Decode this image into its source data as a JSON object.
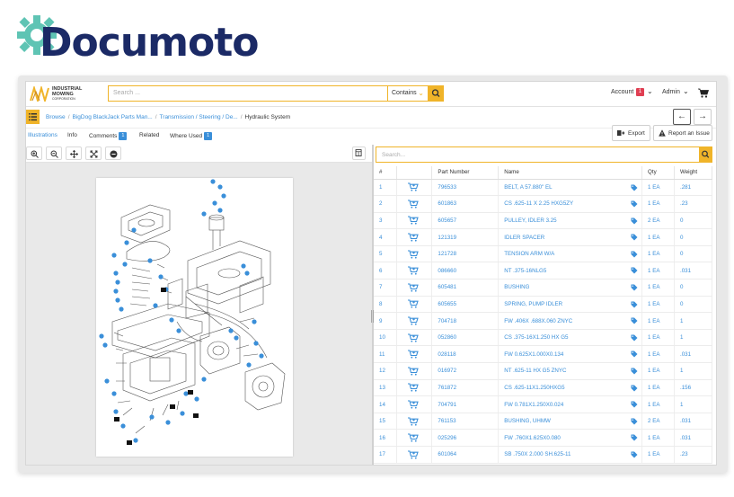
{
  "brand": {
    "name": "Documoto",
    "color": "#1b2a66",
    "gear_color": "#5fc4b4"
  },
  "topbar": {
    "logo_line1": "INDUSTRIAL",
    "logo_line2": "MOWING",
    "logo_line3": "CORPORATION",
    "search_placeholder": "Search ...",
    "contains_label": "Contains",
    "account_label": "Account",
    "account_badge": "1",
    "admin_label": "Admin",
    "accent": "#f0b429"
  },
  "breadcrumb": {
    "items": [
      "Browse",
      "BigDog BlackJack Parts Man...",
      "Transmission / Steering / De...",
      "Hydraulic System"
    ]
  },
  "tabs": {
    "illustrations": "Illustrations",
    "info": "Info",
    "comments": "Comments",
    "comments_count": "1",
    "related": "Related",
    "where_used": "Where Used",
    "where_used_count": "1",
    "export": "Export",
    "report": "Report an Issue"
  },
  "right_panel": {
    "search_placeholder": "Search..."
  },
  "table": {
    "headers": [
      "#",
      "",
      "Part Number",
      "Name",
      "Qty",
      "Weight"
    ],
    "rows": [
      {
        "n": "1",
        "pn": "796533",
        "name": "BELT, A 57.880\" EL",
        "qty": "1 EA",
        "w": ".281"
      },
      {
        "n": "2",
        "pn": "601863",
        "name": "CS .625-11 X 2.25 HXG5ZY",
        "qty": "1 EA",
        "w": ".23"
      },
      {
        "n": "3",
        "pn": "605657",
        "name": "PULLEY, IDLER 3.25",
        "qty": "2 EA",
        "w": "0"
      },
      {
        "n": "4",
        "pn": "121319",
        "name": "IDLER SPACER",
        "qty": "1 EA",
        "w": "0"
      },
      {
        "n": "5",
        "pn": "121728",
        "name": "TENSION ARM W/A",
        "qty": "1 EA",
        "w": "0"
      },
      {
        "n": "6",
        "pn": "086660",
        "name": "NT .375-16NLG5",
        "qty": "1 EA",
        "w": ".031"
      },
      {
        "n": "7",
        "pn": "605481",
        "name": "BUSHING",
        "qty": "1 EA",
        "w": "0"
      },
      {
        "n": "8",
        "pn": "605655",
        "name": "SPRING, PUMP IDLER",
        "qty": "1 EA",
        "w": "0"
      },
      {
        "n": "9",
        "pn": "704718",
        "name": "FW .406X .688X.060 ZNYC",
        "qty": "1 EA",
        "w": "1"
      },
      {
        "n": "10",
        "pn": "052860",
        "name": "CS .375-16X1.250 HX G5",
        "qty": "1 EA",
        "w": "1"
      },
      {
        "n": "11",
        "pn": "028118",
        "name": "FW 0.625X1.000X0.134",
        "qty": "1 EA",
        "w": ".031"
      },
      {
        "n": "12",
        "pn": "016972",
        "name": "NT .625-11 HX G5 ZNYC",
        "qty": "1 EA",
        "w": "1"
      },
      {
        "n": "13",
        "pn": "761872",
        "name": "CS .625-11X1.250HXG5",
        "qty": "1 EA",
        "w": ".156"
      },
      {
        "n": "14",
        "pn": "704791",
        "name": "FW 0.781X1.250X0.024",
        "qty": "1 EA",
        "w": "1"
      },
      {
        "n": "15",
        "pn": "761153",
        "name": "BUSHING, UHMW",
        "qty": "2 EA",
        "w": ".031"
      },
      {
        "n": "16",
        "pn": "025296",
        "name": "FW .760X1.625X0.080",
        "qty": "1 EA",
        "w": ".031"
      },
      {
        "n": "17",
        "pn": "601064",
        "name": "SB .750X 2.000 SH.625-11",
        "qty": "1 EA",
        "w": ".23"
      }
    ]
  }
}
